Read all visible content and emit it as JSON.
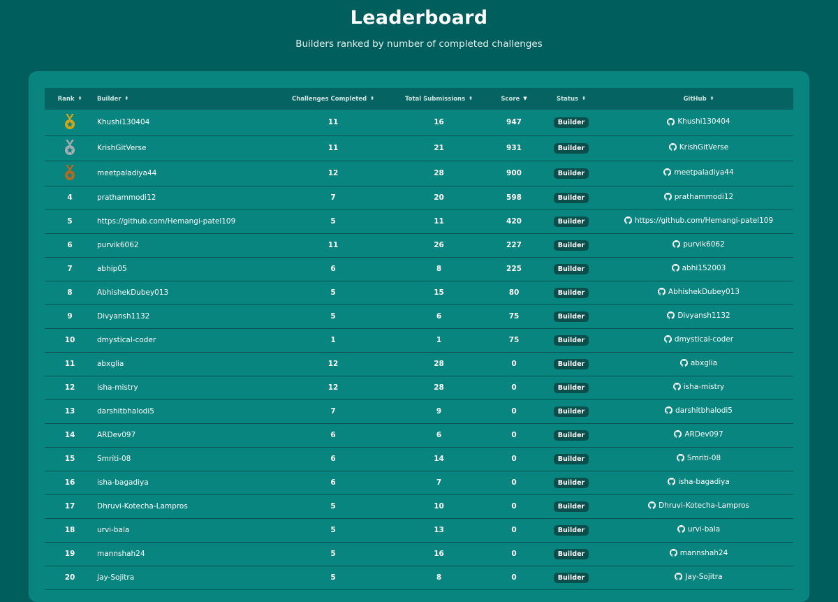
{
  "header": {
    "title": "Leaderboard",
    "subtitle": "Builders ranked by number of completed challenges"
  },
  "columns": {
    "rank": "Rank",
    "builder": "Builder",
    "challenges": "Challenges Completed",
    "submissions": "Total Submissions",
    "score": "Score",
    "status": "Status",
    "github": "GitHub"
  },
  "sort_icons": {
    "unsorted": "⬍",
    "descending": "▼"
  },
  "medal_colors": {
    "gold": "#d4a514",
    "silver": "#a7adb2",
    "bronze": "#b56a20"
  },
  "icons": {
    "medal": "medal-icon",
    "github": "github-icon"
  },
  "rows": [
    {
      "rank": "1",
      "medal": "gold",
      "builder": "Khushi130404",
      "challenges": "11",
      "submissions": "16",
      "score": "947",
      "status": "Builder",
      "github": "Khushi130404"
    },
    {
      "rank": "2",
      "medal": "silver",
      "builder": "KrishGitVerse",
      "challenges": "11",
      "submissions": "21",
      "score": "931",
      "status": "Builder",
      "github": "KrishGitVerse"
    },
    {
      "rank": "3",
      "medal": "bronze",
      "builder": "meetpaladiya44",
      "challenges": "12",
      "submissions": "28",
      "score": "900",
      "status": "Builder",
      "github": "meetpaladiya44"
    },
    {
      "rank": "4",
      "builder": "prathammodi12",
      "challenges": "7",
      "submissions": "20",
      "score": "598",
      "status": "Builder",
      "github": "prathammodi12"
    },
    {
      "rank": "5",
      "builder": "https://github.com/Hemangi-patel109",
      "challenges": "5",
      "submissions": "11",
      "score": "420",
      "status": "Builder",
      "github": "https://github.com/Hemangi-patel109"
    },
    {
      "rank": "6",
      "builder": "purvik6062",
      "challenges": "11",
      "submissions": "26",
      "score": "227",
      "status": "Builder",
      "github": "purvik6062"
    },
    {
      "rank": "7",
      "builder": "abhip05",
      "challenges": "6",
      "submissions": "8",
      "score": "225",
      "status": "Builder",
      "github": "abhi152003"
    },
    {
      "rank": "8",
      "builder": "AbhishekDubey013",
      "challenges": "5",
      "submissions": "15",
      "score": "80",
      "status": "Builder",
      "github": "AbhishekDubey013"
    },
    {
      "rank": "9",
      "builder": "Divyansh1132",
      "challenges": "5",
      "submissions": "6",
      "score": "75",
      "status": "Builder",
      "github": "Divyansh1132"
    },
    {
      "rank": "10",
      "builder": "dmystical-coder",
      "challenges": "1",
      "submissions": "1",
      "score": "75",
      "status": "Builder",
      "github": "dmystical-coder"
    },
    {
      "rank": "11",
      "builder": "abxglia",
      "challenges": "12",
      "submissions": "28",
      "score": "0",
      "status": "Builder",
      "github": "abxglia"
    },
    {
      "rank": "12",
      "builder": "isha-mistry",
      "challenges": "12",
      "submissions": "28",
      "score": "0",
      "status": "Builder",
      "github": "isha-mistry"
    },
    {
      "rank": "13",
      "builder": "darshitbhalodi5",
      "challenges": "7",
      "submissions": "9",
      "score": "0",
      "status": "Builder",
      "github": "darshitbhalodi5"
    },
    {
      "rank": "14",
      "builder": "ARDev097",
      "challenges": "6",
      "submissions": "6",
      "score": "0",
      "status": "Builder",
      "github": "ARDev097"
    },
    {
      "rank": "15",
      "builder": "Smriti-08",
      "challenges": "6",
      "submissions": "14",
      "score": "0",
      "status": "Builder",
      "github": "Smriti-08"
    },
    {
      "rank": "16",
      "builder": "isha-bagadiya",
      "challenges": "6",
      "submissions": "7",
      "score": "0",
      "status": "Builder",
      "github": "isha-bagadiya"
    },
    {
      "rank": "17",
      "builder": "Dhruvi-Kotecha-Lampros",
      "challenges": "5",
      "submissions": "10",
      "score": "0",
      "status": "Builder",
      "github": "Dhruvi-Kotecha-Lampros"
    },
    {
      "rank": "18",
      "builder": "urvi-bala",
      "challenges": "5",
      "submissions": "13",
      "score": "0",
      "status": "Builder",
      "github": "urvi-bala"
    },
    {
      "rank": "19",
      "builder": "mannshah24",
      "challenges": "5",
      "submissions": "16",
      "score": "0",
      "status": "Builder",
      "github": "mannshah24"
    },
    {
      "rank": "20",
      "builder": "Jay-Sojitra",
      "challenges": "5",
      "submissions": "8",
      "score": "0",
      "status": "Builder",
      "github": "Jay-Sojitra"
    }
  ]
}
